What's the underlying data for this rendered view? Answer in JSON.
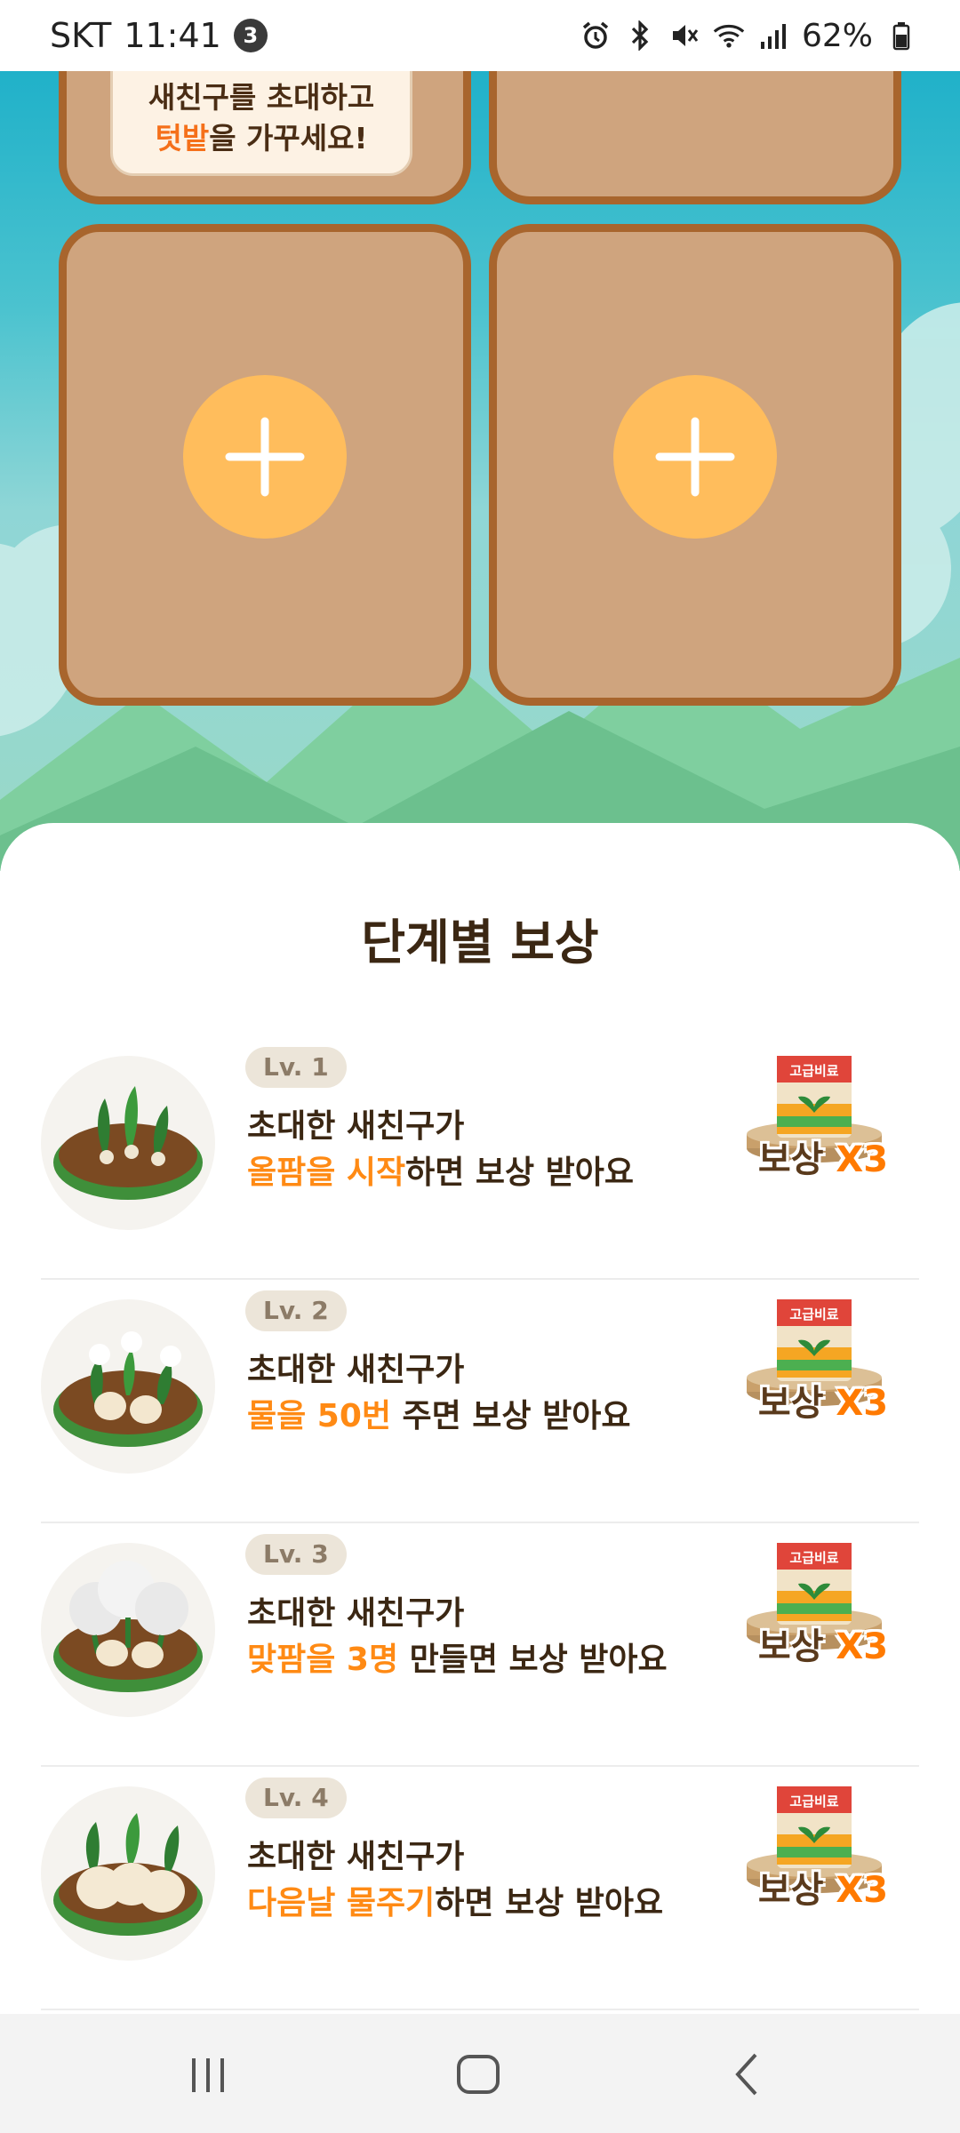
{
  "status_bar": {
    "carrier": "SKT",
    "time": "11:41",
    "notification_count": "3",
    "battery": "62%",
    "icons": [
      "alarm-icon",
      "bluetooth-icon",
      "mute-icon",
      "wifi-icon",
      "signal-icon",
      "battery-icon"
    ]
  },
  "farm": {
    "invite_note_line1": "새친구를 초대하고",
    "invite_note_line2_highlight": "텃밭",
    "invite_note_line2_rest": "을 가꾸세요!",
    "plots": [
      {
        "state": "partial"
      },
      {
        "state": "partial"
      },
      {
        "state": "empty",
        "action": "add"
      },
      {
        "state": "empty",
        "action": "add"
      }
    ]
  },
  "rewards": {
    "title": "단계별 보상",
    "items": [
      {
        "level": "Lv. 1",
        "line1": "초대한 새친구가",
        "highlight": "올팜을 시작",
        "rest": "하면 보상 받아요",
        "bag_label": "고급비료",
        "reward_prefix": "보상 ",
        "reward_mult": "X3"
      },
      {
        "level": "Lv. 2",
        "line1": "초대한 새친구가",
        "highlight": "물을 50번",
        "rest": " 주면 보상 받아요",
        "bag_label": "고급비료",
        "reward_prefix": "보상 ",
        "reward_mult": "X3"
      },
      {
        "level": "Lv. 3",
        "line1": "초대한 새친구가",
        "highlight": "맞팜을 3명",
        "rest": " 만들면 보상 받아요",
        "bag_label": "고급비료",
        "reward_prefix": "보상 ",
        "reward_mult": "X3"
      },
      {
        "level": "Lv. 4",
        "line1": "초대한 새친구가",
        "highlight": "다음날 물주기",
        "rest": "하면 보상 받아요",
        "bag_label": "고급비료",
        "reward_prefix": "보상 ",
        "reward_mult": "X3"
      }
    ]
  },
  "nav": {
    "buttons": [
      "recent-apps",
      "home",
      "back"
    ]
  },
  "colors": {
    "accent_orange": "#ff8a14",
    "plot_fill": "#cfa47e",
    "plot_border": "#a8652d",
    "add_button": "#ffbd5c",
    "sky": "#20b1c9"
  }
}
